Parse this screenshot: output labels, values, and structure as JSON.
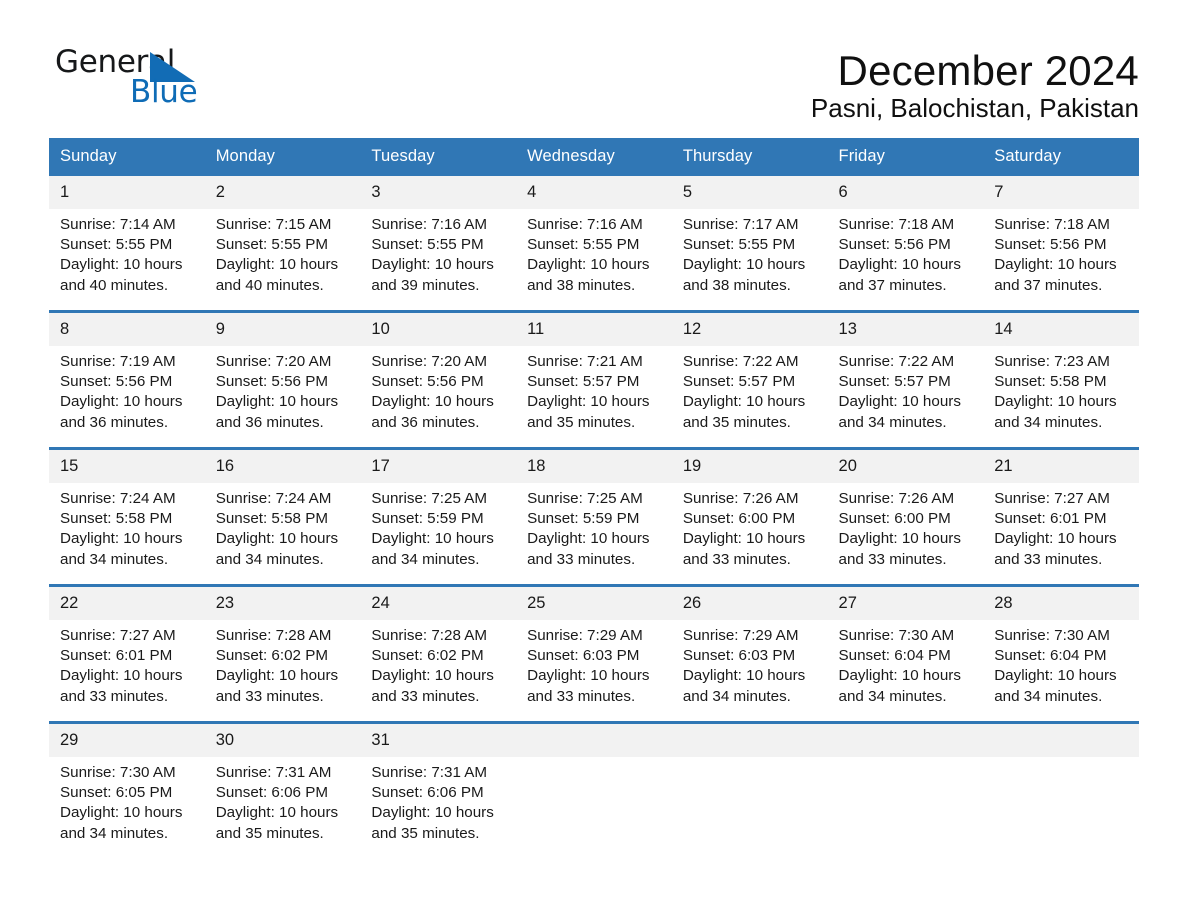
{
  "brand": {
    "word_one": "General",
    "word_two": "Blue",
    "flag_icon": "triangle-flag-icon",
    "accent_color": "#0f6cb6"
  },
  "header": {
    "month_title": "December 2024",
    "location": "Pasni, Balochistan, Pakistan"
  },
  "theme": {
    "header_blue": "#3077b5",
    "daynum_gray": "#f2f2f2",
    "text": "#1a1a1a"
  },
  "calendar": {
    "weekday_headers": [
      "Sunday",
      "Monday",
      "Tuesday",
      "Wednesday",
      "Thursday",
      "Friday",
      "Saturday"
    ],
    "weeks": [
      [
        {
          "day": "1",
          "sunrise": "Sunrise: 7:14 AM",
          "sunset": "Sunset: 5:55 PM",
          "daylight": "Daylight: 10 hours and 40 minutes."
        },
        {
          "day": "2",
          "sunrise": "Sunrise: 7:15 AM",
          "sunset": "Sunset: 5:55 PM",
          "daylight": "Daylight: 10 hours and 40 minutes."
        },
        {
          "day": "3",
          "sunrise": "Sunrise: 7:16 AM",
          "sunset": "Sunset: 5:55 PM",
          "daylight": "Daylight: 10 hours and 39 minutes."
        },
        {
          "day": "4",
          "sunrise": "Sunrise: 7:16 AM",
          "sunset": "Sunset: 5:55 PM",
          "daylight": "Daylight: 10 hours and 38 minutes."
        },
        {
          "day": "5",
          "sunrise": "Sunrise: 7:17 AM",
          "sunset": "Sunset: 5:55 PM",
          "daylight": "Daylight: 10 hours and 38 minutes."
        },
        {
          "day": "6",
          "sunrise": "Sunrise: 7:18 AM",
          "sunset": "Sunset: 5:56 PM",
          "daylight": "Daylight: 10 hours and 37 minutes."
        },
        {
          "day": "7",
          "sunrise": "Sunrise: 7:18 AM",
          "sunset": "Sunset: 5:56 PM",
          "daylight": "Daylight: 10 hours and 37 minutes."
        }
      ],
      [
        {
          "day": "8",
          "sunrise": "Sunrise: 7:19 AM",
          "sunset": "Sunset: 5:56 PM",
          "daylight": "Daylight: 10 hours and 36 minutes."
        },
        {
          "day": "9",
          "sunrise": "Sunrise: 7:20 AM",
          "sunset": "Sunset: 5:56 PM",
          "daylight": "Daylight: 10 hours and 36 minutes."
        },
        {
          "day": "10",
          "sunrise": "Sunrise: 7:20 AM",
          "sunset": "Sunset: 5:56 PM",
          "daylight": "Daylight: 10 hours and 36 minutes."
        },
        {
          "day": "11",
          "sunrise": "Sunrise: 7:21 AM",
          "sunset": "Sunset: 5:57 PM",
          "daylight": "Daylight: 10 hours and 35 minutes."
        },
        {
          "day": "12",
          "sunrise": "Sunrise: 7:22 AM",
          "sunset": "Sunset: 5:57 PM",
          "daylight": "Daylight: 10 hours and 35 minutes."
        },
        {
          "day": "13",
          "sunrise": "Sunrise: 7:22 AM",
          "sunset": "Sunset: 5:57 PM",
          "daylight": "Daylight: 10 hours and 34 minutes."
        },
        {
          "day": "14",
          "sunrise": "Sunrise: 7:23 AM",
          "sunset": "Sunset: 5:58 PM",
          "daylight": "Daylight: 10 hours and 34 minutes."
        }
      ],
      [
        {
          "day": "15",
          "sunrise": "Sunrise: 7:24 AM",
          "sunset": "Sunset: 5:58 PM",
          "daylight": "Daylight: 10 hours and 34 minutes."
        },
        {
          "day": "16",
          "sunrise": "Sunrise: 7:24 AM",
          "sunset": "Sunset: 5:58 PM",
          "daylight": "Daylight: 10 hours and 34 minutes."
        },
        {
          "day": "17",
          "sunrise": "Sunrise: 7:25 AM",
          "sunset": "Sunset: 5:59 PM",
          "daylight": "Daylight: 10 hours and 34 minutes."
        },
        {
          "day": "18",
          "sunrise": "Sunrise: 7:25 AM",
          "sunset": "Sunset: 5:59 PM",
          "daylight": "Daylight: 10 hours and 33 minutes."
        },
        {
          "day": "19",
          "sunrise": "Sunrise: 7:26 AM",
          "sunset": "Sunset: 6:00 PM",
          "daylight": "Daylight: 10 hours and 33 minutes."
        },
        {
          "day": "20",
          "sunrise": "Sunrise: 7:26 AM",
          "sunset": "Sunset: 6:00 PM",
          "daylight": "Daylight: 10 hours and 33 minutes."
        },
        {
          "day": "21",
          "sunrise": "Sunrise: 7:27 AM",
          "sunset": "Sunset: 6:01 PM",
          "daylight": "Daylight: 10 hours and 33 minutes."
        }
      ],
      [
        {
          "day": "22",
          "sunrise": "Sunrise: 7:27 AM",
          "sunset": "Sunset: 6:01 PM",
          "daylight": "Daylight: 10 hours and 33 minutes."
        },
        {
          "day": "23",
          "sunrise": "Sunrise: 7:28 AM",
          "sunset": "Sunset: 6:02 PM",
          "daylight": "Daylight: 10 hours and 33 minutes."
        },
        {
          "day": "24",
          "sunrise": "Sunrise: 7:28 AM",
          "sunset": "Sunset: 6:02 PM",
          "daylight": "Daylight: 10 hours and 33 minutes."
        },
        {
          "day": "25",
          "sunrise": "Sunrise: 7:29 AM",
          "sunset": "Sunset: 6:03 PM",
          "daylight": "Daylight: 10 hours and 33 minutes."
        },
        {
          "day": "26",
          "sunrise": "Sunrise: 7:29 AM",
          "sunset": "Sunset: 6:03 PM",
          "daylight": "Daylight: 10 hours and 34 minutes."
        },
        {
          "day": "27",
          "sunrise": "Sunrise: 7:30 AM",
          "sunset": "Sunset: 6:04 PM",
          "daylight": "Daylight: 10 hours and 34 minutes."
        },
        {
          "day": "28",
          "sunrise": "Sunrise: 7:30 AM",
          "sunset": "Sunset: 6:04 PM",
          "daylight": "Daylight: 10 hours and 34 minutes."
        }
      ],
      [
        {
          "day": "29",
          "sunrise": "Sunrise: 7:30 AM",
          "sunset": "Sunset: 6:05 PM",
          "daylight": "Daylight: 10 hours and 34 minutes."
        },
        {
          "day": "30",
          "sunrise": "Sunrise: 7:31 AM",
          "sunset": "Sunset: 6:06 PM",
          "daylight": "Daylight: 10 hours and 35 minutes."
        },
        {
          "day": "31",
          "sunrise": "Sunrise: 7:31 AM",
          "sunset": "Sunset: 6:06 PM",
          "daylight": "Daylight: 10 hours and 35 minutes."
        },
        {
          "day": "",
          "sunrise": "",
          "sunset": "",
          "daylight": ""
        },
        {
          "day": "",
          "sunrise": "",
          "sunset": "",
          "daylight": ""
        },
        {
          "day": "",
          "sunrise": "",
          "sunset": "",
          "daylight": ""
        },
        {
          "day": "",
          "sunrise": "",
          "sunset": "",
          "daylight": ""
        }
      ]
    ]
  }
}
